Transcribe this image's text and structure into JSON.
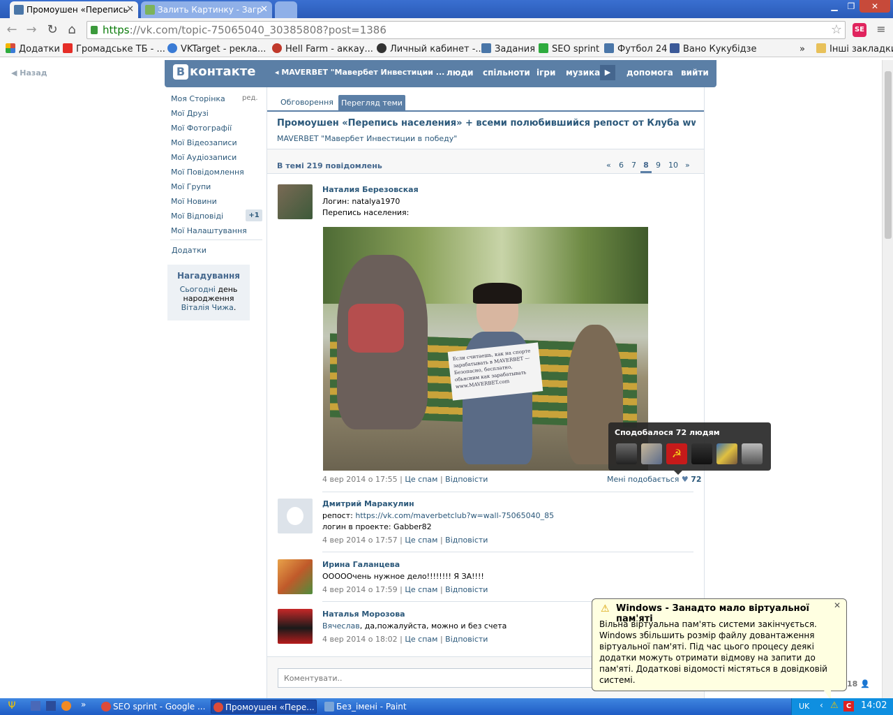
{
  "browser": {
    "tabs": [
      {
        "title": "Промоушен «Перепись"
      },
      {
        "title": "Залить Картинку - Загр"
      }
    ],
    "url_scheme": "https",
    "url_rest": "://vk.com/topic-75065040_30385808?post=1386",
    "bookmarks": [
      {
        "label": "Додатки",
        "color": "#d94b3b"
      },
      {
        "label": "Громадське ТБ - ...",
        "color": "#e52d27"
      },
      {
        "label": "VKTarget - рекла...",
        "color": "#3a7bd5"
      },
      {
        "label": "Hell Farm - аккау...",
        "color": "#c0392b"
      },
      {
        "label": "Личный кабинет -...",
        "color": "#333333"
      },
      {
        "label": "Задания",
        "color": "#4a76a8"
      },
      {
        "label": "SEO sprint",
        "color": "#2eab3e"
      },
      {
        "label": "Футбол 24",
        "color": "#4a76a8"
      },
      {
        "label": "Вано Кукубідзе",
        "color": "#3b5998"
      }
    ],
    "bookmarks_more": "»",
    "other_bookmarks": "Інші закладки"
  },
  "vk": {
    "back": "Назад",
    "logo": "Вконтакте",
    "header_group": "MAVERBET \"Мавербет Инвестиции ...",
    "nav": [
      "люди",
      "спільноти",
      "ігри",
      "музика",
      "допомога",
      "вийти"
    ],
    "sidebar": {
      "items": [
        "Моя Сторінка",
        "Мої Друзі",
        "Мої Фотографії",
        "Мої Відеозаписи",
        "Мої Аудіозаписи",
        "Мої Повідомлення",
        "Мої Групи",
        "Мої Новини",
        "Мої Відповіді",
        "Мої Налаштування"
      ],
      "edit": "ред.",
      "answers_badge": "+1",
      "apps": "Додатки",
      "reminder_title": "Нагадування",
      "reminder_today": "Сьогодні",
      "reminder_mid": " день народження ",
      "reminder_name": "Віталія Чижа",
      "reminder_end": "."
    },
    "tabs": [
      "Обговорення",
      "Перегляд теми"
    ],
    "topic_title": "Промоушен «Перепись населения» + всеми полюбившийся репост от Клуба www.maverbet...",
    "topic_group": "MAVERBET \"Мавербет Инвестиции в победу\"",
    "count_text": "В темі 219 повідомлень",
    "pages": [
      "«",
      "6",
      "7",
      "8",
      "9",
      "10",
      "»"
    ],
    "posts": [
      {
        "author": "Наталия Березовская",
        "lines": [
          "Логин: natalya1970",
          "Перепись населения:"
        ],
        "date": "4 вер 2014 о 17:55"
      },
      {
        "author": "Дмитрий Маракулин",
        "repost_label": "репост: ",
        "repost_link": "https://vk.com/maverbetclub?w=wall-75065040_85",
        "line2": "логин в проекте: Gabber82",
        "date": "4 вер 2014 о 17:57"
      },
      {
        "author": "Ирина Галанцева",
        "text": "ОООООчень нужное дело!!!!!!!! Я ЗА!!!!",
        "date": "4 вер 2014 о 17:59"
      },
      {
        "author": "Наталья Морозова",
        "mention": "Вячеслав",
        "text": ", да,пожалуйста, можно и без счета",
        "date": "4 вер 2014 о 18:02"
      }
    ],
    "spam": "Це спам",
    "reply": "Відповісти",
    "photo_sign": "Если считаешь, как на спорте зарабатывать в MAVERBET — Безопасно, бесплатно, обьясним как зарабатывать www.MAVERBET.com",
    "like_text": "Мені подобається",
    "like_count": "72",
    "tooltip_title": "Сподобалося 72 людям",
    "comment_placeholder": "Коментувати..",
    "bottom_count": "18"
  },
  "balloon": {
    "title": "Windows - Занадто мало віртуальної пам'яті",
    "text": "Вільна віртуальна пам'ять системи закінчується. Windows збільшить розмір файлу довантаження віртуальної пам'яті. Під час цього процесу деякі додатки можуть отримати відмову на запити до пам'яті. Додаткові відомості містяться в довідковій системі."
  },
  "taskbar": {
    "items": [
      "SEO sprint - Google ...",
      "Промоушен «Пере...",
      "Без_імені - Paint"
    ],
    "more": "»",
    "lang": "UK",
    "time": "14:02"
  }
}
